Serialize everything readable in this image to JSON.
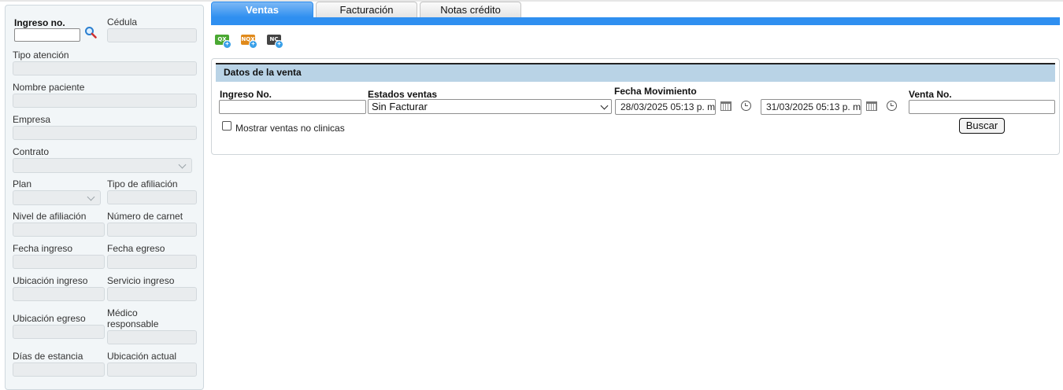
{
  "tabs": [
    {
      "label": "Ventas"
    },
    {
      "label": "Facturación"
    },
    {
      "label": "Notas crédito"
    }
  ],
  "toolbar": [
    {
      "text": "QX",
      "color": "#4aa832"
    },
    {
      "text": "NQX",
      "color": "#e08a1c"
    },
    {
      "text": "NC",
      "color": "#444444"
    }
  ],
  "sidebar": {
    "ingreso_label": "Ingreso no.",
    "cedula_label": "Cédula",
    "tipo_atencion_label": "Tipo atención",
    "nombre_paciente_label": "Nombre paciente",
    "empresa_label": "Empresa",
    "contrato_label": "Contrato",
    "plan_label": "Plan",
    "tipo_afiliacion_label": "Tipo de afiliación",
    "nivel_afiliacion_label": "Nivel de afiliación",
    "numero_carnet_label": "Número de carnet",
    "fecha_ingreso_label": "Fecha ingreso",
    "fecha_egreso_label": "Fecha egreso",
    "ubicacion_ingreso_label": "Ubicación ingreso",
    "servicio_ingreso_label": "Servicio ingreso",
    "ubicacion_egreso_label": "Ubicación egreso",
    "medico_responsable_label_1": "Médico",
    "medico_responsable_label_2": "responsable",
    "dias_estancia_label": "Días de estancia",
    "ubicacion_actual_label": "Ubicación actual"
  },
  "panel": {
    "title": "Datos de la venta",
    "ingreso_label": "Ingreso No.",
    "estados_label": "Estados ventas",
    "estados_value": "Sin Facturar",
    "fecha_label": "Fecha Movimiento",
    "fecha_desde": "28/03/2025 05:13 p. m.",
    "fecha_hasta": "31/03/2025 05:13 p. m.",
    "venta_label": "Venta No.",
    "mostrar_label": "Mostrar ventas no clinicas",
    "buscar_label": "Buscar"
  }
}
